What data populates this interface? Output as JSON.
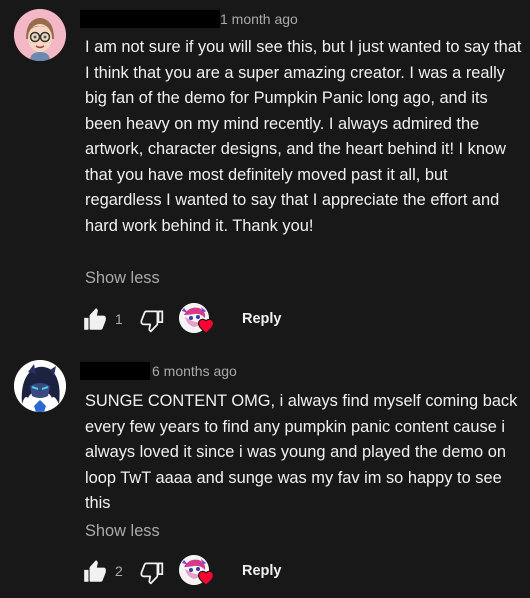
{
  "comments": [
    {
      "timestamp": "1 month ago",
      "text": "I am not sure if you will see this, but I just wanted to say that I think that you are a super amazing creator. I was a really big fan of the demo for Pumpkin Panic long ago, and its been heavy on my mind recently. I always admired the artwork, character designs, and the heart behind it! I know that you have most definitely moved past it all, but regardless I wanted to say that I appreciate the effort and hard work behind it. Thank you!",
      "show_less": "Show less",
      "like_count": "1",
      "reply_label": "Reply",
      "avatar_icon": "cartoon-glasses-avatar-icon"
    },
    {
      "timestamp": "6 months ago",
      "text": "SUNGE CONTENT OMG, i always find myself coming back every few years to find any pumpkin panic content cause i always loved it since i was young and played the demo on loop TwT aaaa and sunge was my fav im so happy to see this",
      "show_less": "Show less",
      "like_count": "2",
      "reply_label": "Reply",
      "avatar_icon": "dark-haired-character-avatar-icon"
    }
  ],
  "icons": {
    "like": "thumbs-up-icon",
    "dislike": "thumbs-down-icon",
    "creator_heart": "creator-heart-icon"
  },
  "colors": {
    "background": "#181818",
    "text": "#f1f1f1",
    "secondary_text": "#aaaaaa",
    "heart": "#ff0033"
  }
}
